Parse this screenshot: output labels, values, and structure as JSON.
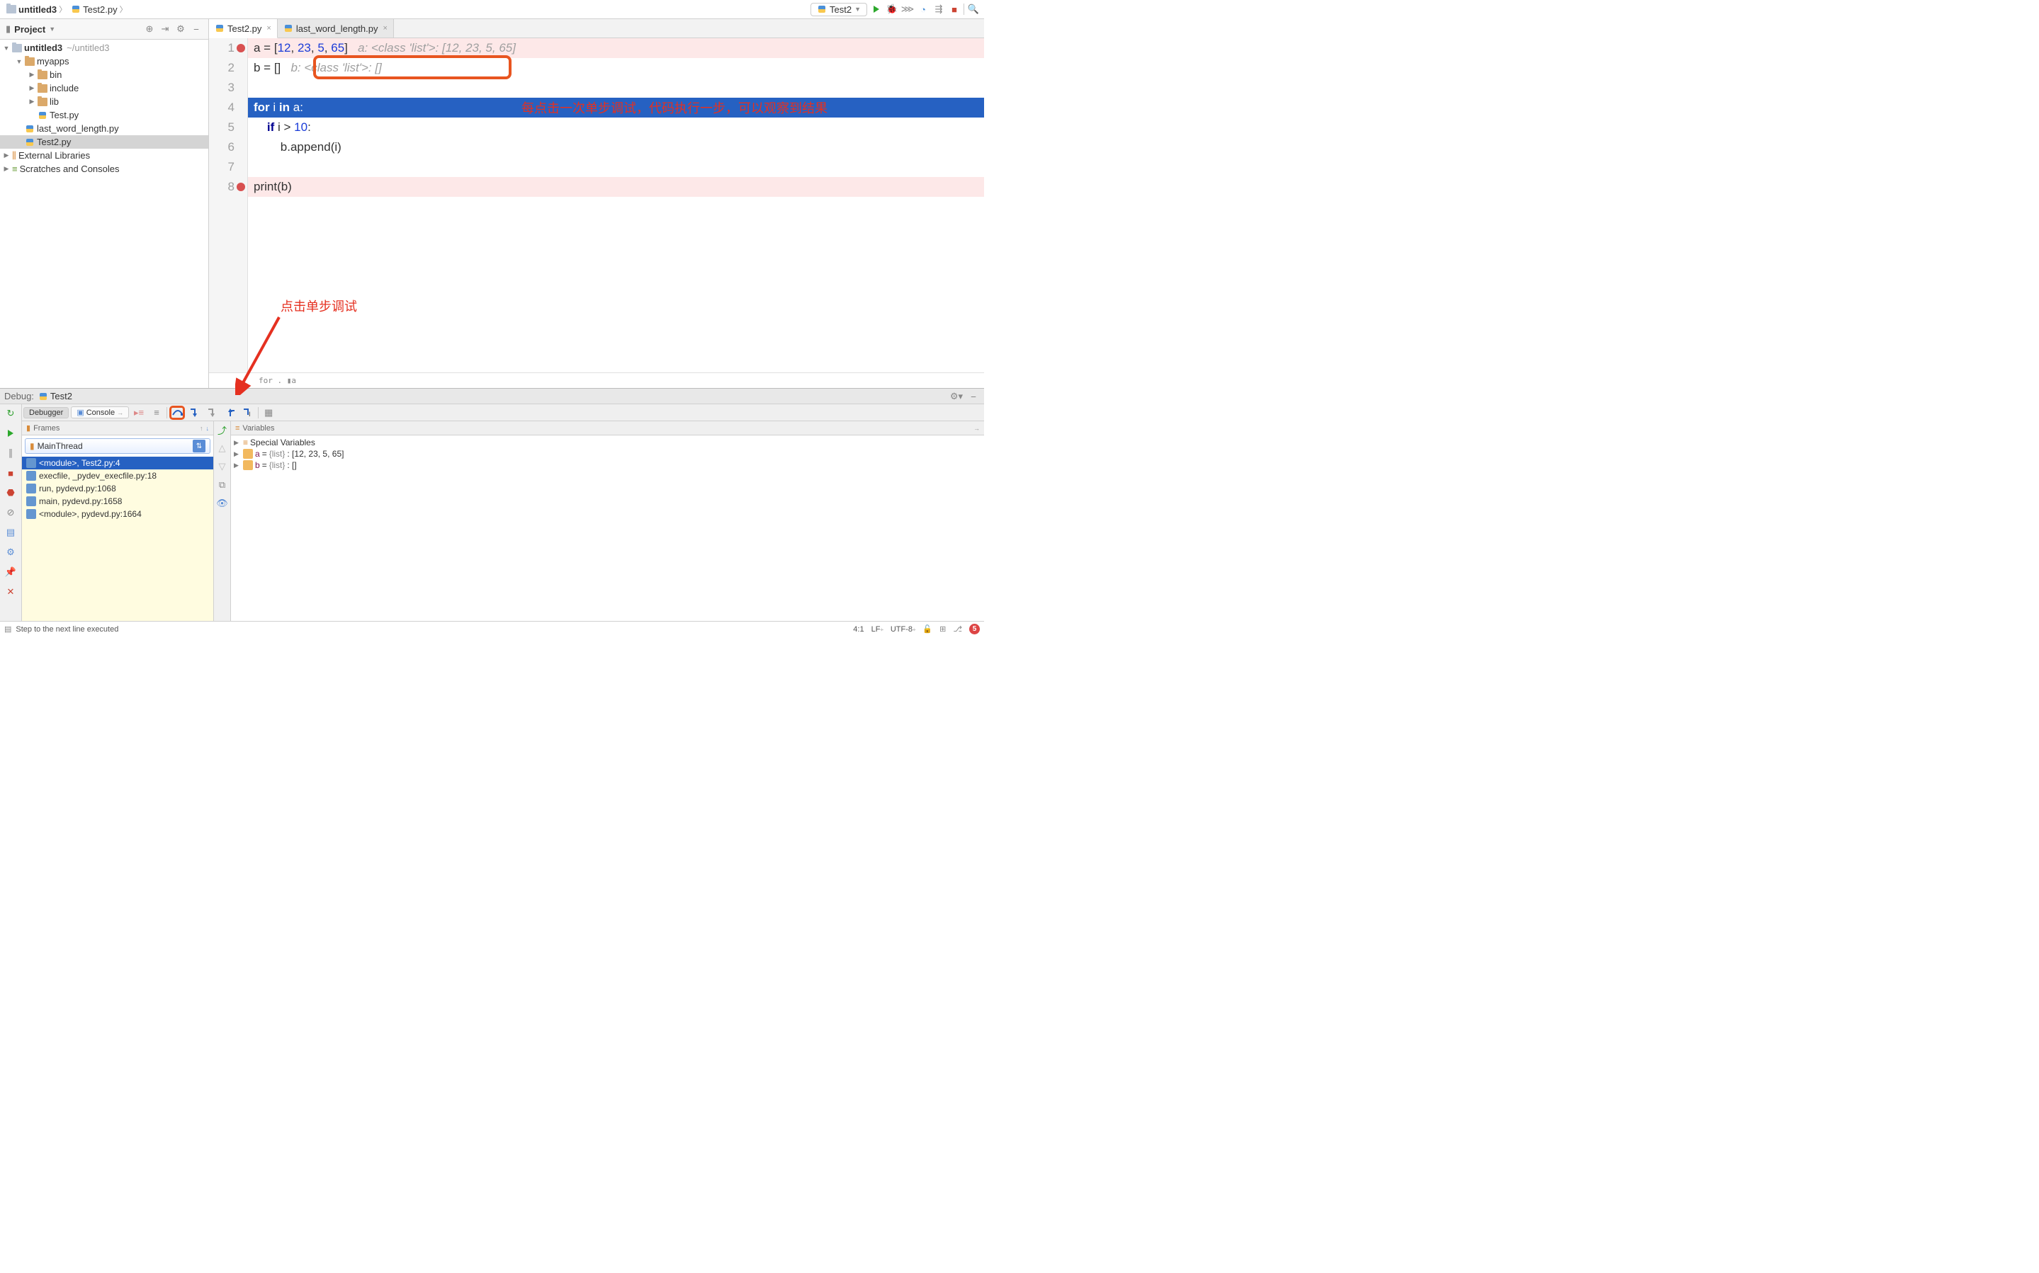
{
  "breadcrumb": {
    "project": "untitled3",
    "file": "Test2.py"
  },
  "run_config": "Test2",
  "project_panel": {
    "title": "Project",
    "root": {
      "name": "untitled3",
      "path": "~/untitled3"
    },
    "items": [
      {
        "name": "myapps",
        "depth": 1,
        "type": "folder",
        "expanded": true
      },
      {
        "name": "bin",
        "depth": 2,
        "type": "folder"
      },
      {
        "name": "include",
        "depth": 2,
        "type": "folder"
      },
      {
        "name": "lib",
        "depth": 2,
        "type": "folder"
      },
      {
        "name": "Test.py",
        "depth": 2,
        "type": "py"
      },
      {
        "name": "last_word_length.py",
        "depth": 1,
        "type": "py"
      },
      {
        "name": "Test2.py",
        "depth": 1,
        "type": "py",
        "selected": true
      }
    ],
    "external": "External Libraries",
    "scratches": "Scratches and Consoles"
  },
  "tabs": [
    {
      "label": "Test2.py",
      "active": true
    },
    {
      "label": "last_word_length.py",
      "active": false
    }
  ],
  "code": {
    "lines": [
      {
        "n": 1,
        "bp": true,
        "text_parts": [
          {
            "t": "a = ["
          },
          {
            "t": "12",
            "c": "num"
          },
          {
            "t": ", "
          },
          {
            "t": "23",
            "c": "num"
          },
          {
            "t": ", "
          },
          {
            "t": "5",
            "c": "num"
          },
          {
            "t": ", "
          },
          {
            "t": "65",
            "c": "num"
          },
          {
            "t": "]   "
          },
          {
            "t": "a: <class 'list'>: [12, 23, 5, 65]",
            "c": "hint"
          }
        ]
      },
      {
        "n": 2,
        "text_parts": [
          {
            "t": "b = []   "
          },
          {
            "t": "b: <class 'list'>: []",
            "c": "hint"
          }
        ]
      },
      {
        "n": 3,
        "text_parts": [
          {
            "t": ""
          }
        ]
      },
      {
        "n": 4,
        "exec": true,
        "text_parts": [
          {
            "t": "for",
            "c": "kw"
          },
          {
            "t": " i "
          },
          {
            "t": "in",
            "c": "kw"
          },
          {
            "t": " a:"
          }
        ]
      },
      {
        "n": 5,
        "text_parts": [
          {
            "t": "    "
          },
          {
            "t": "if",
            "c": "kw"
          },
          {
            "t": " i > "
          },
          {
            "t": "10",
            "c": "num"
          },
          {
            "t": ":"
          }
        ]
      },
      {
        "n": 6,
        "text_parts": [
          {
            "t": "        b.append(i)"
          }
        ]
      },
      {
        "n": 7,
        "text_parts": [
          {
            "t": ""
          }
        ]
      },
      {
        "n": 8,
        "bp": true,
        "text_parts": [
          {
            "t": "print(b)"
          }
        ]
      }
    ],
    "breadcrumb": "for . ▮a"
  },
  "annotations": {
    "text1": "每点击一次单步调试，代码执行一步，可以观察到结果",
    "text2": "点击单步调试"
  },
  "debug_header": {
    "label": "Debug:",
    "name": "Test2"
  },
  "debug_tabs": {
    "debugger": "Debugger",
    "console": "Console"
  },
  "frames": {
    "title": "Frames",
    "thread": "MainThread",
    "items": [
      {
        "label": "<module>, Test2.py:4",
        "selected": true
      },
      {
        "label": "execfile, _pydev_execfile.py:18"
      },
      {
        "label": "run, pydevd.py:1068"
      },
      {
        "label": "main, pydevd.py:1658"
      },
      {
        "label": "<module>, pydevd.py:1664"
      }
    ]
  },
  "variables": {
    "title": "Variables",
    "special": "Special Variables",
    "items": [
      {
        "name": "a",
        "type": "{list}",
        "value": "<class 'list'>: [12, 23, 5, 65]"
      },
      {
        "name": "b",
        "type": "{list}",
        "value": "<class 'list'>: []"
      }
    ]
  },
  "status": {
    "hint": "Step to the next line executed",
    "pos": "4:1",
    "sep": "LF",
    "enc": "UTF-8",
    "notif": "5"
  }
}
